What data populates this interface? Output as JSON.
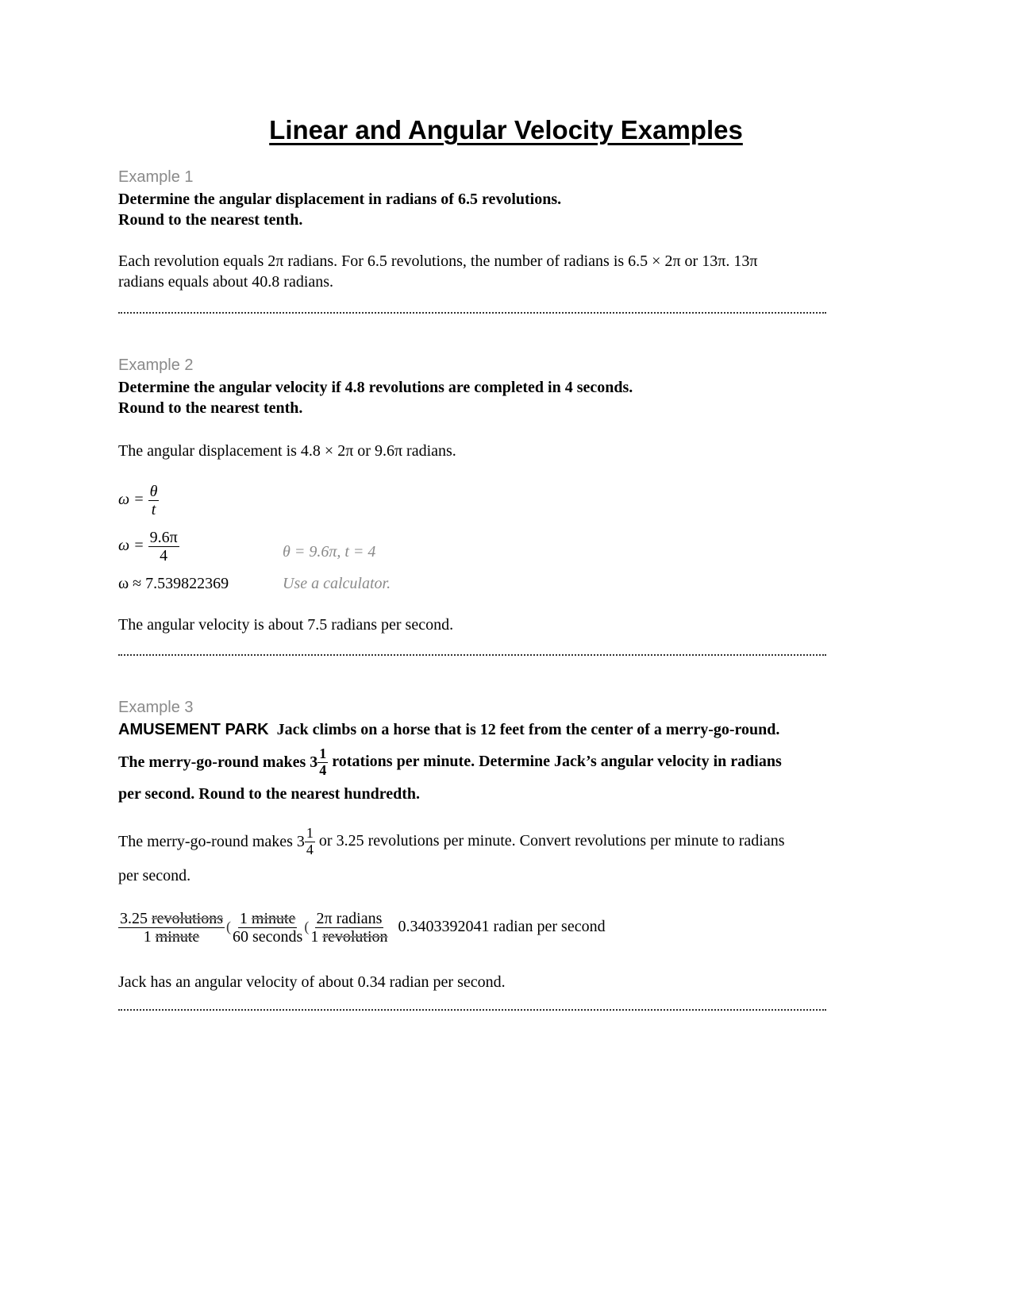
{
  "title": "Linear and Angular Velocity Examples",
  "examples": [
    {
      "label": "Example 1",
      "problem_line1": "Determine the angular displacement in radians of 6.5 revolutions.",
      "problem_line2": "Round to the nearest tenth.",
      "solution_line1": "Each revolution equals 2π radians. For 6.5 revolutions, the number of radians is 6.5 × 2π or 13π. 13π",
      "solution_line2": "radians equals about 40.8 radians."
    },
    {
      "label": "Example 2",
      "problem_line1": "Determine the angular velocity if 4.8 revolutions are completed in 4 seconds.",
      "problem_line2": "Round to the nearest tenth.",
      "solution_line1": "The angular displacement is 4.8 × 2π or 9.6π radians.",
      "eq1": {
        "lhs": "ω =",
        "num": "θ",
        "den": "t"
      },
      "eq2": {
        "lhs": "ω =",
        "num": "9.6π",
        "den": "4",
        "note": "θ = 9.6π, t = 4"
      },
      "eq3": {
        "text": "ω ≈ 7.539822369",
        "note": "Use a calculator."
      },
      "conclusion": "The angular velocity is about 7.5 radians per second."
    },
    {
      "label": "Example 3",
      "topic": "AMUSEMENT PARK",
      "problem_line1": "Jack climbs on a horse that is 12 feet from the center of a merry-go-round.",
      "problem_line2_a": "The merry-go-round makes 3",
      "mixed_num": "1",
      "mixed_den": "4",
      "problem_line2_b": "rotations per minute. Determine Jack’s angular velocity in radians",
      "problem_line3": "per second. Round to the nearest hundredth.",
      "solution_line1_a": "The merry-go-round makes 3",
      "solution_line1_b": "or 3.25 revolutions per minute. Convert revolutions per minute to radians",
      "solution_line2": "per second.",
      "conv": {
        "f1_num_val": "3.25 ",
        "f1_num_unit": "revolutions",
        "f1_den_val": "1 ",
        "f1_den_unit": "minute",
        "f2_num_val": "1 ",
        "f2_num_unit": "minute",
        "f2_den": "60 seconds",
        "f3_num": "2π radians",
        "f3_den_val": "1 ",
        "f3_den_unit": "revolution",
        "result": "0.3403392041 radian per second"
      },
      "conclusion": "Jack has an angular velocity of about 0.34 radian per second."
    }
  ]
}
